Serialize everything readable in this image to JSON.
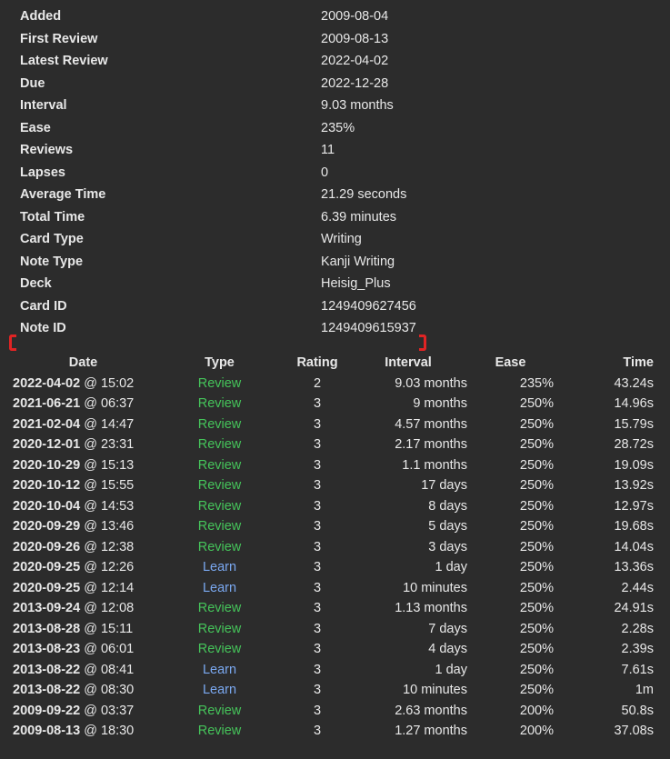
{
  "colors": {
    "background": "#2c2c2c",
    "text": "#e8e8e8",
    "review": "#45c45a",
    "learn": "#7aa8f0",
    "annotation": "#e02424"
  },
  "info": [
    {
      "label": "Added",
      "value": "2009-08-04"
    },
    {
      "label": "First Review",
      "value": "2009-08-13"
    },
    {
      "label": "Latest Review",
      "value": "2022-04-02"
    },
    {
      "label": "Due",
      "value": "2022-12-28"
    },
    {
      "label": "Interval",
      "value": "9.03 months"
    },
    {
      "label": "Ease",
      "value": "235%"
    },
    {
      "label": "Reviews",
      "value": "11"
    },
    {
      "label": "Lapses",
      "value": "0"
    },
    {
      "label": "Average Time",
      "value": "21.29 seconds"
    },
    {
      "label": "Total Time",
      "value": "6.39 minutes"
    },
    {
      "label": "Card Type",
      "value": "Writing"
    },
    {
      "label": "Note Type",
      "value": "Kanji Writing"
    },
    {
      "label": "Deck",
      "value": "Heisig_Plus"
    },
    {
      "label": "Card ID",
      "value": "1249409627456"
    },
    {
      "label": "Note ID",
      "value": "1249409615937"
    }
  ],
  "revlog": {
    "headers": {
      "date": "Date",
      "type": "Type",
      "rating": "Rating",
      "interval": "Interval",
      "ease": "Ease",
      "time": "Time"
    },
    "rows": [
      {
        "date": "2022-04-02",
        "time_of_day": "@ 15:02",
        "type": "Review",
        "rating": "2",
        "interval": "9.03 months",
        "ease": "235%",
        "time": "43.24s"
      },
      {
        "date": "2021-06-21",
        "time_of_day": "@ 06:37",
        "type": "Review",
        "rating": "3",
        "interval": "9 months",
        "ease": "250%",
        "time": "14.96s"
      },
      {
        "date": "2021-02-04",
        "time_of_day": "@ 14:47",
        "type": "Review",
        "rating": "3",
        "interval": "4.57 months",
        "ease": "250%",
        "time": "15.79s"
      },
      {
        "date": "2020-12-01",
        "time_of_day": "@ 23:31",
        "type": "Review",
        "rating": "3",
        "interval": "2.17 months",
        "ease": "250%",
        "time": "28.72s"
      },
      {
        "date": "2020-10-29",
        "time_of_day": "@ 15:13",
        "type": "Review",
        "rating": "3",
        "interval": "1.1 months",
        "ease": "250%",
        "time": "19.09s"
      },
      {
        "date": "2020-10-12",
        "time_of_day": "@ 15:55",
        "type": "Review",
        "rating": "3",
        "interval": "17 days",
        "ease": "250%",
        "time": "13.92s"
      },
      {
        "date": "2020-10-04",
        "time_of_day": "@ 14:53",
        "type": "Review",
        "rating": "3",
        "interval": "8 days",
        "ease": "250%",
        "time": "12.97s"
      },
      {
        "date": "2020-09-29",
        "time_of_day": "@ 13:46",
        "type": "Review",
        "rating": "3",
        "interval": "5 days",
        "ease": "250%",
        "time": "19.68s"
      },
      {
        "date": "2020-09-26",
        "time_of_day": "@ 12:38",
        "type": "Review",
        "rating": "3",
        "interval": "3 days",
        "ease": "250%",
        "time": "14.04s"
      },
      {
        "date": "2020-09-25",
        "time_of_day": "@ 12:26",
        "type": "Learn",
        "rating": "3",
        "interval": "1 day",
        "ease": "250%",
        "time": "13.36s"
      },
      {
        "date": "2020-09-25",
        "time_of_day": "@ 12:14",
        "type": "Learn",
        "rating": "3",
        "interval": "10 minutes",
        "ease": "250%",
        "time": "2.44s"
      },
      {
        "date": "2013-09-24",
        "time_of_day": "@ 12:08",
        "type": "Review",
        "rating": "3",
        "interval": "1.13 months",
        "ease": "250%",
        "time": "24.91s"
      },
      {
        "date": "2013-08-28",
        "time_of_day": "@ 15:11",
        "type": "Review",
        "rating": "3",
        "interval": "7 days",
        "ease": "250%",
        "time": "2.28s"
      },
      {
        "date": "2013-08-23",
        "time_of_day": "@ 06:01",
        "type": "Review",
        "rating": "3",
        "interval": "4 days",
        "ease": "250%",
        "time": "2.39s"
      },
      {
        "date": "2013-08-22",
        "time_of_day": "@ 08:41",
        "type": "Learn",
        "rating": "3",
        "interval": "1 day",
        "ease": "250%",
        "time": "7.61s"
      },
      {
        "date": "2013-08-22",
        "time_of_day": "@ 08:30",
        "type": "Learn",
        "rating": "3",
        "interval": "10 minutes",
        "ease": "250%",
        "time": "1m"
      },
      {
        "date": "2009-09-22",
        "time_of_day": "@ 03:37",
        "type": "Review",
        "rating": "3",
        "interval": "2.63 months",
        "ease": "200%",
        "time": "50.8s"
      },
      {
        "date": "2009-08-13",
        "time_of_day": "@ 18:30",
        "type": "Review",
        "rating": "3",
        "interval": "1.27 months",
        "ease": "200%",
        "time": "37.08s"
      }
    ]
  }
}
